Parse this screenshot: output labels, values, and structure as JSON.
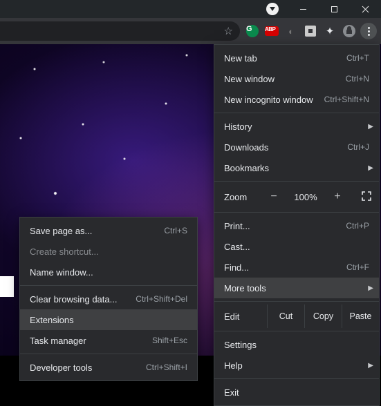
{
  "toolbar": {
    "ext_abp": "ABP",
    "ext_g": "G"
  },
  "menu": {
    "new_tab": {
      "label": "New tab",
      "shortcut": "Ctrl+T"
    },
    "new_window": {
      "label": "New window",
      "shortcut": "Ctrl+N"
    },
    "new_incognito": {
      "label": "New incognito window",
      "shortcut": "Ctrl+Shift+N"
    },
    "history": {
      "label": "History"
    },
    "downloads": {
      "label": "Downloads",
      "shortcut": "Ctrl+J"
    },
    "bookmarks": {
      "label": "Bookmarks"
    },
    "zoom": {
      "label": "Zoom",
      "minus": "−",
      "pct": "100%",
      "plus": "+"
    },
    "print": {
      "label": "Print...",
      "shortcut": "Ctrl+P"
    },
    "cast": {
      "label": "Cast..."
    },
    "find": {
      "label": "Find...",
      "shortcut": "Ctrl+F"
    },
    "more_tools": {
      "label": "More tools"
    },
    "edit": {
      "label": "Edit",
      "cut": "Cut",
      "copy": "Copy",
      "paste": "Paste"
    },
    "settings": {
      "label": "Settings"
    },
    "help": {
      "label": "Help"
    },
    "exit": {
      "label": "Exit"
    }
  },
  "submenu": {
    "save_page": {
      "label": "Save page as...",
      "shortcut": "Ctrl+S"
    },
    "create_shortcut": {
      "label": "Create shortcut..."
    },
    "name_window": {
      "label": "Name window..."
    },
    "clear_data": {
      "label": "Clear browsing data...",
      "shortcut": "Ctrl+Shift+Del"
    },
    "extensions": {
      "label": "Extensions"
    },
    "task_manager": {
      "label": "Task manager",
      "shortcut": "Shift+Esc"
    },
    "dev_tools": {
      "label": "Developer tools",
      "shortcut": "Ctrl+Shift+I"
    }
  }
}
